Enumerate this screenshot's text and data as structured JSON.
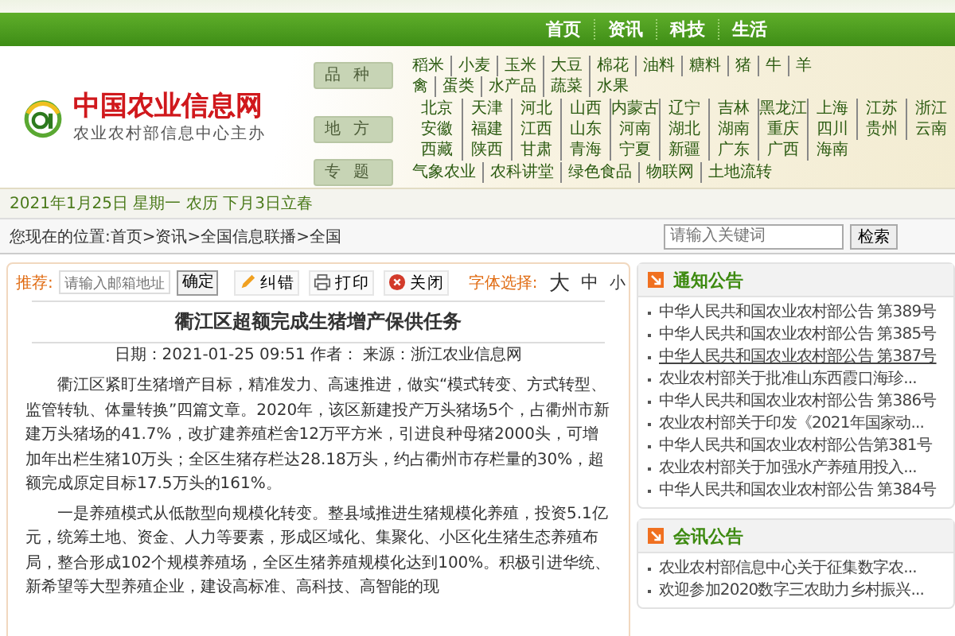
{
  "top_nav": {
    "items": [
      "首页",
      "资讯",
      "科技",
      "生活"
    ]
  },
  "header": {
    "site_name": "中国农业信息网",
    "tagline": "农业农村部信息中心主办",
    "menu_groups": [
      {
        "label": "品种",
        "rows": [
          [
            "稻米",
            "小麦",
            "玉米",
            "大豆",
            "棉花",
            "油料",
            "糖料",
            "猪",
            "牛",
            "羊"
          ],
          [
            "禽",
            "蛋类",
            "水产品",
            "蔬菜",
            "水果"
          ]
        ]
      },
      {
        "label": "地方",
        "rows": [
          [
            "北京",
            "天津",
            "河北",
            "山西",
            "内蒙古",
            "辽宁",
            "吉林",
            "黑龙江",
            "上海",
            "江苏",
            "浙江"
          ],
          [
            "安徽",
            "福建",
            "江西",
            "山东",
            "河南",
            "湖北",
            "湖南",
            "重庆",
            "四川",
            "贵州",
            "云南"
          ],
          [
            "西藏",
            "陕西",
            "甘肃",
            "青海",
            "宁夏",
            "新疆",
            "广东",
            "广西",
            "海南"
          ]
        ]
      },
      {
        "label": "专题",
        "rows": [
          [
            "气象农业",
            "农科讲堂",
            "绿色食品",
            "物联网",
            "土地流转"
          ]
        ]
      }
    ]
  },
  "date_line": "2021年1月25日 星期一 农历 下月3日立春",
  "breadcrumb": "您现在的位置:首页>资讯>全国信息联播>全国",
  "search": {
    "placeholder": "请输入关键词",
    "button": "检索"
  },
  "article": {
    "toolbar": {
      "recommend_label": "推荐:",
      "email_placeholder": "请输入邮箱地址",
      "confirm": "确定",
      "actions": [
        {
          "kind": "edit",
          "label": "纠错"
        },
        {
          "kind": "print",
          "label": "打印"
        },
        {
          "kind": "close",
          "label": "关闭"
        }
      ],
      "font_label": "字体选择:",
      "font_sizes": [
        "大",
        "中",
        "小"
      ]
    },
    "title": "衢江区超额完成生猪增产保供任务",
    "meta": "日期：2021-01-25 09:51 作者： 来源：浙江农业信息网",
    "paragraphs": [
      "衢江区紧盯生猪增产目标，精准发力、高速推进，做实“模式转变、方式转型、监管转轨、体量转换”四篇文章。2020年，该区新建投产万头猪场5个，占衢州市新建万头猪场的41.7%，改扩建养殖栏舍12万平方米，引进良种母猪2000头，可增加年出栏生猪10万头；全区生猪存栏达28.18万头，约占衢州市存栏量的30%，超额完成原定目标17.5万头的161%。",
      "一是养殖模式从低散型向规模化转变。整县域推进生猪规模化养殖，投资5.1亿元，统筹土地、资金、人力等要素，形成区域化、集聚化、小区化生猪生态养殖布局，整合形成102个规模养殖场，全区生猪养殖规模化达到100%。积极引进华统、新希望等大型养殖企业，建设高标准、高科技、高智能的现"
    ]
  },
  "sidebar": [
    {
      "title": "通知公告",
      "items": [
        {
          "text": "中华人民共和国农业农村部公告 第389号",
          "hovered": false
        },
        {
          "text": "中华人民共和国农业农村部公告 第385号",
          "hovered": false
        },
        {
          "text": "中华人民共和国农业农村部公告 第387号",
          "hovered": true
        },
        {
          "text": "农业农村部关于批准山东西霞口海珍...",
          "hovered": false
        },
        {
          "text": "中华人民共和国农业农村部公告 第386号",
          "hovered": false
        },
        {
          "text": "农业农村部关于印发《2021年国家动...",
          "hovered": false
        },
        {
          "text": "中华人民共和国农业农村部公告第381号",
          "hovered": false
        },
        {
          "text": "农业农村部关于加强水产养殖用投入...",
          "hovered": false
        },
        {
          "text": "中华人民共和国农业农村部公告 第384号",
          "hovered": false
        }
      ]
    },
    {
      "title": "会讯公告",
      "items": [
        {
          "text": "农业农村部信息中心关于征集数字农...",
          "hovered": false
        },
        {
          "text": "欢迎参加2020数字三农助力乡村振兴...",
          "hovered": false
        }
      ]
    }
  ]
}
